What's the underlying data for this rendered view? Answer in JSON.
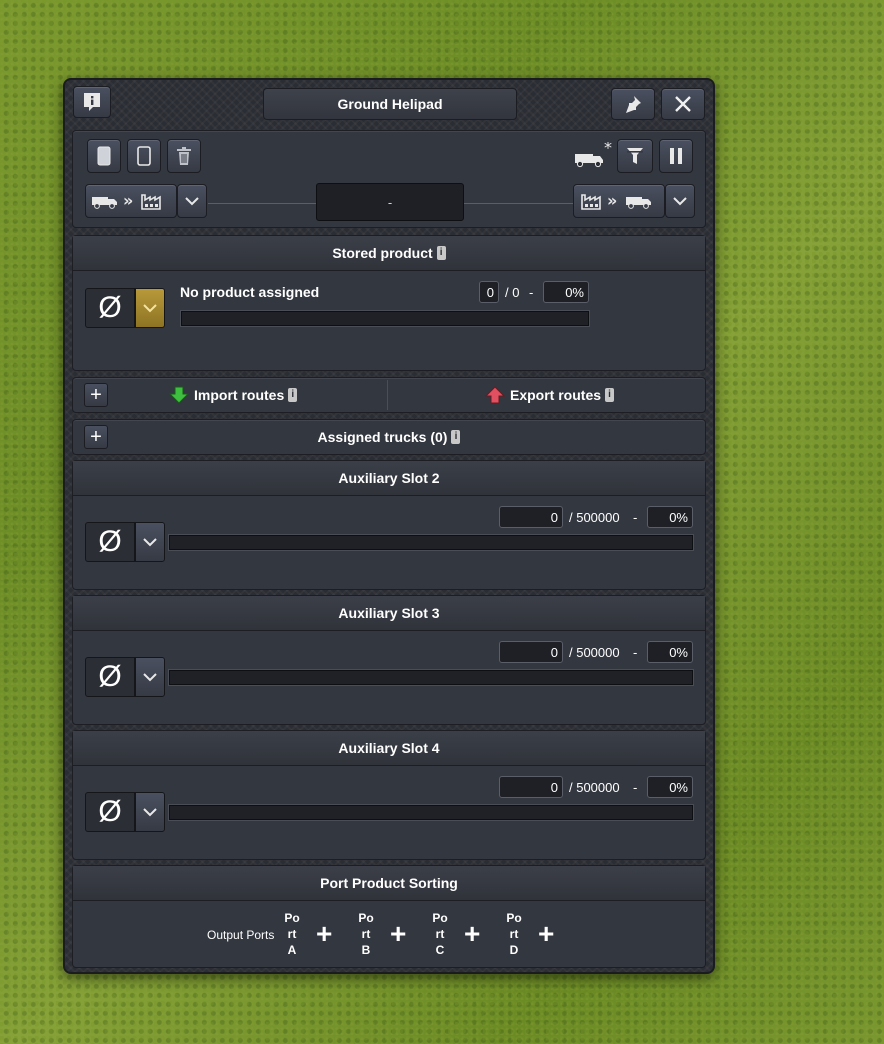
{
  "window": {
    "title": "Ground Helipad"
  },
  "toolbar": {
    "status_text": "-"
  },
  "stored_product": {
    "header": "Stored product",
    "product_label": "No product assigned",
    "amount": "0",
    "capacity_text": "/ 0",
    "dash": "-",
    "percent": "0%"
  },
  "routes": {
    "import_label": "Import routes",
    "export_label": "Export routes"
  },
  "trucks": {
    "label": "Assigned trucks (0)"
  },
  "aux_slots": [
    {
      "header": "Auxiliary Slot 2",
      "amount": "0",
      "capacity_text": "/ 500000",
      "dash": "-",
      "percent": "0%"
    },
    {
      "header": "Auxiliary Slot 3",
      "amount": "0",
      "capacity_text": "/ 500000",
      "dash": "-",
      "percent": "0%"
    },
    {
      "header": "Auxiliary Slot 4",
      "amount": "0",
      "capacity_text": "/ 500000",
      "dash": "-",
      "percent": "0%"
    }
  ],
  "sorting": {
    "header": "Port Product Sorting",
    "output_label": "Output Ports",
    "ports": [
      {
        "line1": "Po",
        "line2": "rt",
        "line3": "A"
      },
      {
        "line1": "Po",
        "line2": "rt",
        "line3": "B"
      },
      {
        "line1": "Po",
        "line2": "rt",
        "line3": "C"
      },
      {
        "line1": "Po",
        "line2": "rt",
        "line3": "D"
      }
    ]
  },
  "common": {
    "info_glyph": "i",
    "null_glyph": "Ø",
    "plus_glyph": "+"
  },
  "colors": {
    "import_arrow": "#3fbf3f",
    "export_arrow": "#e05060",
    "accent_yellow": "#b89a3a"
  }
}
